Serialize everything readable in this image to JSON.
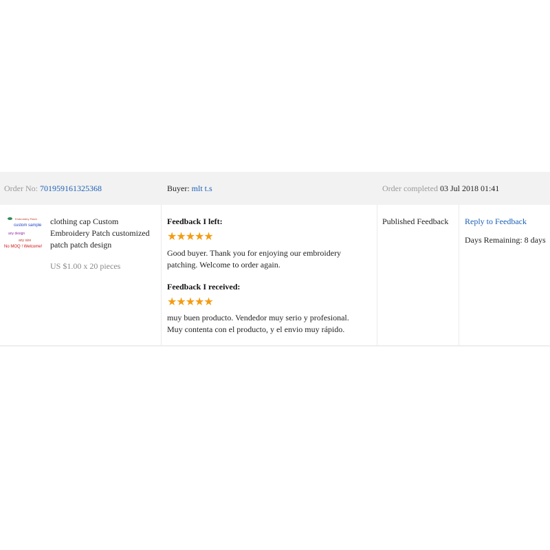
{
  "order": {
    "number_label": "Order No:",
    "number": "701959161325368",
    "buyer_label": "Buyer:",
    "buyer_name": "mlt t.s",
    "completed_label": "Order completed",
    "completed_date": "03 Jul 2018 01:41"
  },
  "product": {
    "thumbnail_lines": [
      "Embroidery Patch",
      "custom sample",
      "any design",
      "any size",
      "No MOQ ! Welcome!"
    ],
    "name": "clothing cap Custom Embroidery Patch customized patch patch design",
    "price": "US $1.00 x 20 pieces"
  },
  "feedback_left": {
    "title": "Feedback I left:",
    "rating": 5,
    "stars": "★★★★★",
    "text": "Good buyer. Thank you for enjoying our embroidery patching. Welcome to order again."
  },
  "feedback_received": {
    "title": "Feedback I received:",
    "rating": 5,
    "stars": "★★★★★",
    "text": "muy buen producto. Vendedor muy serio y profesional. Muy contenta con el producto, y el envio muy rápido."
  },
  "status": {
    "label": "Published Feedback"
  },
  "actions": {
    "reply_label": "Reply to Feedback",
    "days_remaining": "Days Remaining: 8 days"
  },
  "colors": {
    "link": "#1a5fb4",
    "star": "#f39c12",
    "header_bg": "#f2f2f2"
  }
}
